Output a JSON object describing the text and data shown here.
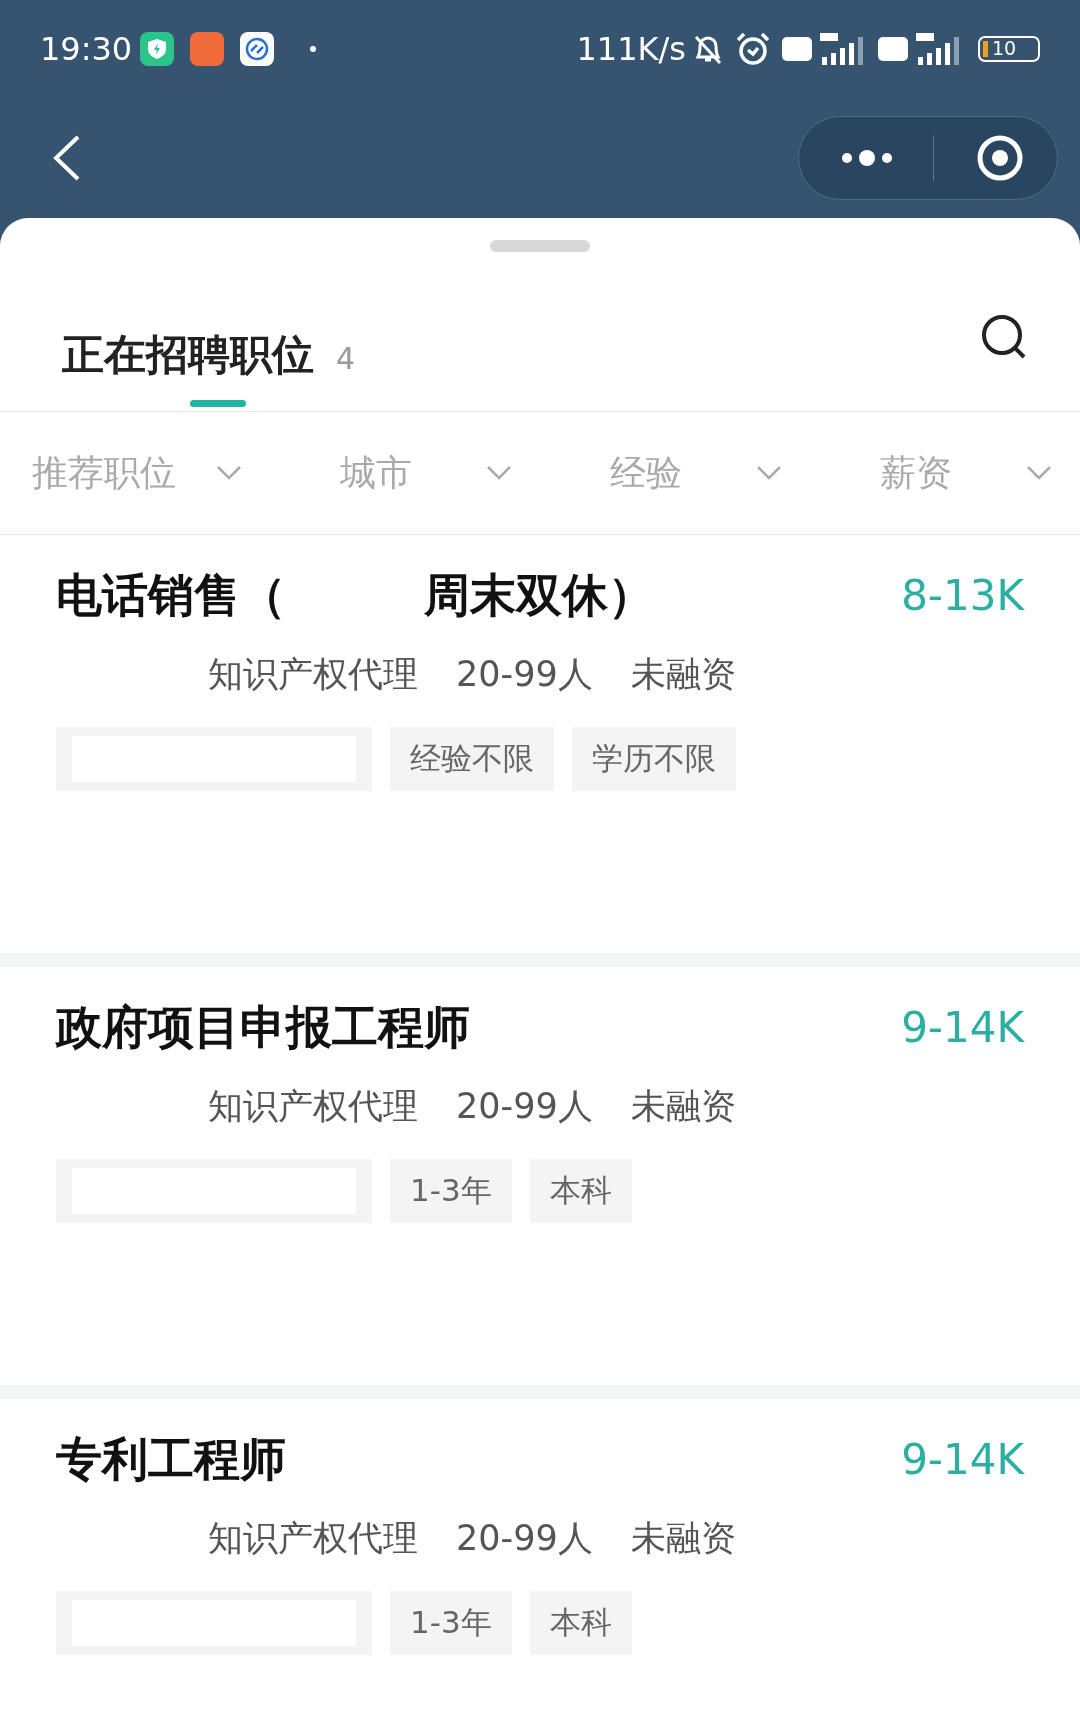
{
  "status_bar": {
    "time": "19:30",
    "network_speed": "111K/s",
    "battery": "10"
  },
  "sheet": {
    "tab": {
      "label": "正在招聘职位",
      "count": "4",
      "selected": true
    },
    "filters": [
      {
        "label": "推荐职位"
      },
      {
        "label": "城市"
      },
      {
        "label": "经验"
      },
      {
        "label": "薪资"
      }
    ],
    "jobs": [
      {
        "title": "电话销售（　　　周末双休）",
        "salary": "8-13K",
        "meta": [
          "知识产权代理",
          "20-99人",
          "未融资"
        ],
        "tags": [
          "经验不限",
          "学历不限"
        ]
      },
      {
        "title": "政府项目申报工程师",
        "salary": "9-14K",
        "meta": [
          "知识产权代理",
          "20-99人",
          "未融资"
        ],
        "tags": [
          "1-3年",
          "本科"
        ]
      },
      {
        "title": "专利工程师",
        "salary": "9-14K",
        "meta": [
          "知识产权代理",
          "20-99人",
          "未融资"
        ],
        "tags": [
          "1-3年",
          "本科"
        ]
      }
    ]
  }
}
